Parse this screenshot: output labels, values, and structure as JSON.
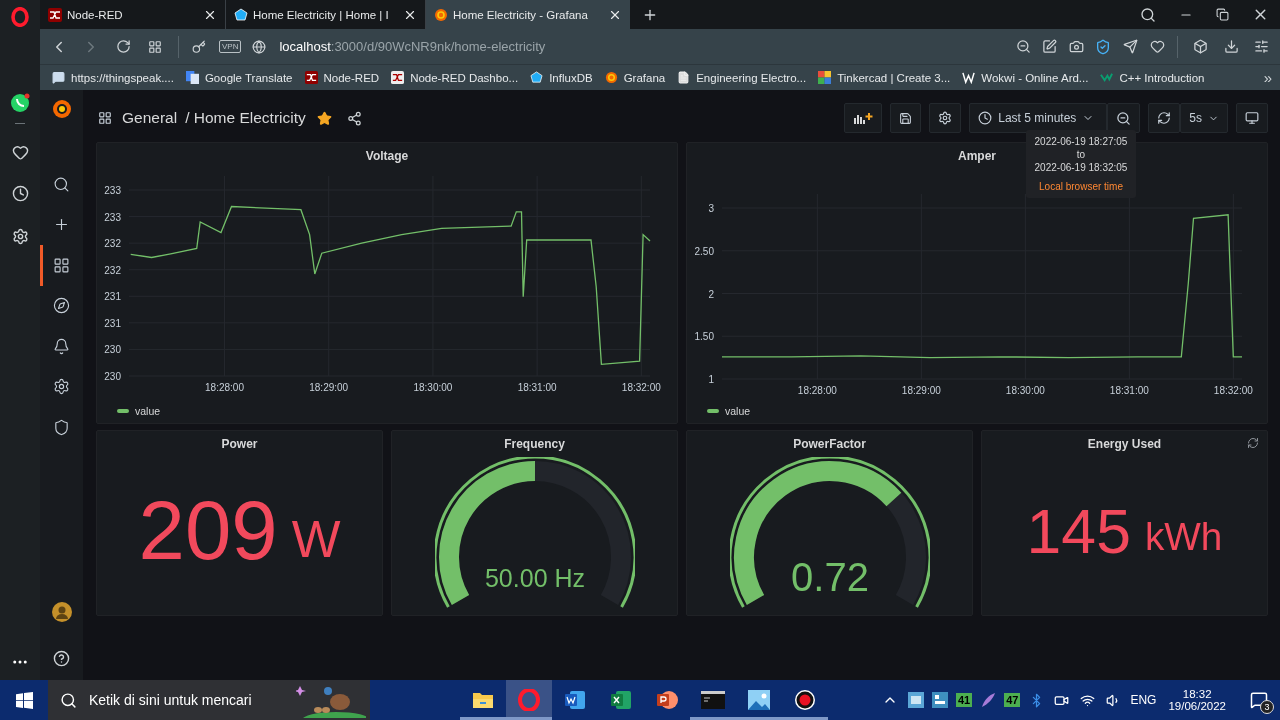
{
  "browser": {
    "tabs": [
      {
        "title": "Node-RED",
        "kind": "nodered",
        "selected": false
      },
      {
        "title": "Home Electricity | Home | I",
        "kind": "influx",
        "selected": false
      },
      {
        "title": "Home Electricity - Grafana",
        "kind": "grafana",
        "selected": true
      }
    ],
    "vpn_badge": "VPN",
    "address": {
      "host": "localhost",
      "path": ":3000/d/90WcNR9nk/home-electricity"
    },
    "bookmarks": [
      {
        "label": "https://thingspeak....",
        "kind": "comment"
      },
      {
        "label": "Google Translate",
        "kind": "translate"
      },
      {
        "label": "Node-RED",
        "kind": "nodered"
      },
      {
        "label": "Node-RED Dashbo...",
        "kind": "nodered-dash"
      },
      {
        "label": "InfluxDB",
        "kind": "influx"
      },
      {
        "label": "Grafana",
        "kind": "grafana"
      },
      {
        "label": "Engineering Electro...",
        "kind": "page"
      },
      {
        "label": "Tinkercad | Create 3...",
        "kind": "tinkercad"
      },
      {
        "label": "Wokwi - Online Ard...",
        "kind": "wokwi"
      },
      {
        "label": "C++ Introduction",
        "kind": "cpp"
      }
    ],
    "bookmarks_more": "»"
  },
  "grafana": {
    "sidemenu": [
      {
        "kind": "search",
        "selected": false
      },
      {
        "kind": "create",
        "selected": false
      },
      {
        "kind": "dashboards",
        "selected": true
      },
      {
        "kind": "explore",
        "selected": false
      },
      {
        "kind": "alerting",
        "selected": false
      },
      {
        "kind": "configuration",
        "selected": false
      },
      {
        "kind": "admin",
        "selected": false
      }
    ],
    "breadcrumb": {
      "folder": "General",
      "title": "/ Home Electricity",
      "starred": true
    },
    "time_range": "Last 5 minutes",
    "refresh_interval": "5s",
    "time_tooltip": {
      "from": "2022-06-19 18:27:05",
      "separator": "to",
      "to": "2022-06-19 18:32:05",
      "zone": "Local browser time"
    },
    "graphs": [
      {
        "title": "Voltage",
        "chart_data": {
          "type": "line",
          "grid": true,
          "x": [
            66426,
            66438,
            66449,
            66464,
            66466,
            66478,
            66484,
            66524,
            66529,
            66532,
            66536,
            66559,
            66582,
            66605,
            66645,
            66648,
            66651,
            66652,
            66654,
            66691,
            66694,
            66697,
            66719,
            66721,
            66725
          ],
          "xlim": [
            66425,
            66725
          ],
          "ylim": [
            230,
            233.5
          ],
          "xticks": [
            {
              "value": 66480,
              "label": "18:28:00"
            },
            {
              "value": 66540,
              "label": "18:29:00"
            },
            {
              "value": 66600,
              "label": "18:30:00"
            },
            {
              "value": 66660,
              "label": "18:31:00"
            },
            {
              "value": 66720,
              "label": "18:32:00"
            }
          ],
          "yticks": [
            {
              "value": 230,
              "label": "230"
            },
            {
              "value": 230.5,
              "label": "230"
            },
            {
              "value": 231,
              "label": "231"
            },
            {
              "value": 231.5,
              "label": "231"
            },
            {
              "value": 232,
              "label": "232"
            },
            {
              "value": 232.5,
              "label": "232"
            },
            {
              "value": 233,
              "label": "233"
            },
            {
              "value": 233.5,
              "label": "233"
            }
          ],
          "series": [
            {
              "name": "value",
              "color": "#73bf69",
              "values": [
                232.29,
                232.23,
                232.3,
                232.4,
                232.9,
                232.7,
                233.19,
                233.13,
                232.66,
                231.92,
                232.31,
                232.5,
                232.66,
                232.78,
                232.82,
                233.09,
                233.09,
                231.49,
                232.56,
                232.56,
                231.68,
                230.22,
                230.28,
                232.66,
                232.54
              ]
            }
          ]
        }
      },
      {
        "title": "Amper",
        "chart_data": {
          "type": "line",
          "grid": true,
          "x": [
            66425,
            66465,
            66505,
            66545,
            66585,
            66625,
            66665,
            66690,
            66694,
            66697,
            66717,
            66720,
            66725
          ],
          "xlim": [
            66425,
            66725
          ],
          "ylim": [
            1,
            3
          ],
          "xticks": [
            {
              "value": 66480,
              "label": "18:28:00"
            },
            {
              "value": 66540,
              "label": "18:29:00"
            },
            {
              "value": 66600,
              "label": "18:30:00"
            },
            {
              "value": 66660,
              "label": "18:31:00"
            },
            {
              "value": 66720,
              "label": "18:32:00"
            }
          ],
          "yticks": [
            {
              "value": 1,
              "label": "1"
            },
            {
              "value": 1.5,
              "label": "1.50"
            },
            {
              "value": 2,
              "label": "2"
            },
            {
              "value": 2.5,
              "label": "2.50"
            },
            {
              "value": 3,
              "label": "3"
            }
          ],
          "series": [
            {
              "name": "value",
              "color": "#73bf69",
              "values": [
                1.26,
                1.26,
                1.27,
                1.25,
                1.26,
                1.25,
                1.26,
                1.26,
                2.12,
                2.88,
                2.92,
                1.26,
                1.26
              ]
            }
          ]
        }
      }
    ],
    "stats": [
      {
        "kind": "stat",
        "title": "Power",
        "value": "209",
        "unit": "W",
        "loading": false
      },
      {
        "kind": "gauge",
        "title": "Frequency",
        "value": "50.00 Hz",
        "loading": false
      },
      {
        "kind": "gauge",
        "title": "PowerFactor",
        "value": "0.72",
        "loading": false
      },
      {
        "kind": "stat",
        "title": "Energy Used",
        "value": "145",
        "unit": "kWh",
        "loading": true
      }
    ]
  },
  "taskbar": {
    "search_placeholder": "Ketik di sini untuk mencari",
    "apps": [
      {
        "kind": "explorer",
        "selected": false,
        "running": true
      },
      {
        "kind": "opera",
        "selected": true,
        "running": true
      },
      {
        "kind": "word",
        "selected": false,
        "running": false
      },
      {
        "kind": "excel",
        "selected": false,
        "running": false
      },
      {
        "kind": "powerpoint",
        "selected": false,
        "running": false
      },
      {
        "kind": "terminal",
        "selected": false,
        "running": true
      },
      {
        "kind": "photos",
        "selected": false,
        "running": true
      },
      {
        "kind": "recorder",
        "selected": false,
        "running": true
      }
    ],
    "tray_badges": [
      "41",
      "47"
    ],
    "language": "ENG",
    "time": "18:32",
    "date": "19/06/2022",
    "notifications": "3"
  }
}
